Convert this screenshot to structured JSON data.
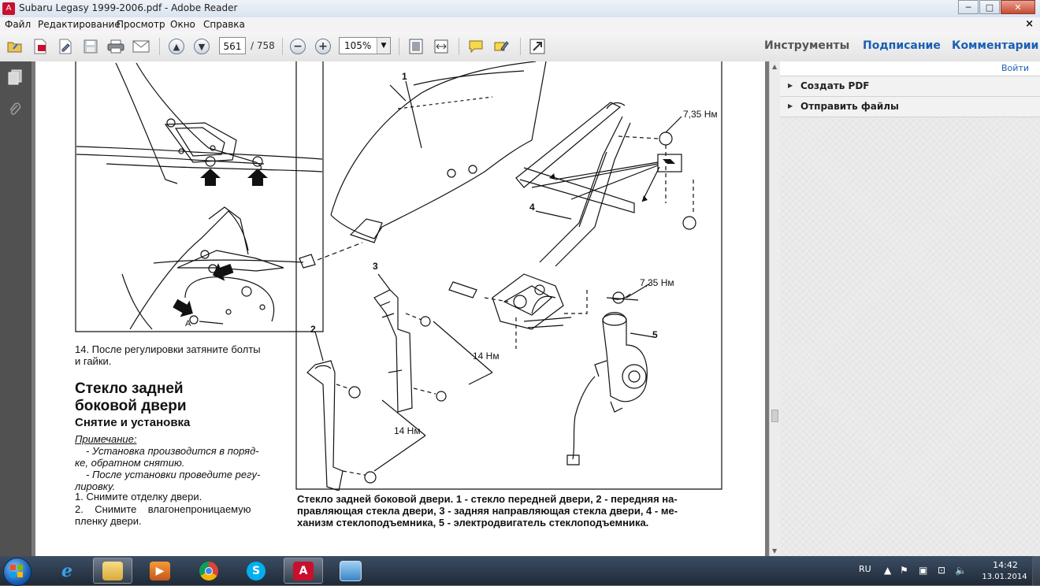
{
  "window": {
    "title": "Subaru Legasy 1999-2006.pdf - Adobe Reader",
    "min": "─",
    "max": "□",
    "close": "✕"
  },
  "menu": {
    "items": [
      "Файл",
      "Редактирование",
      "Просмотр",
      "Окно",
      "Справка"
    ],
    "close": "×"
  },
  "toolbar": {
    "page_current": "561",
    "page_total": "/ 758",
    "zoom": "105%"
  },
  "panels": {
    "tools": "Инструменты",
    "sign": "Подписание",
    "comments": "Комментарии"
  },
  "right_pane": {
    "login": "Войти",
    "create_pdf": "Создать PDF",
    "send_files": "Отправить файлы"
  },
  "doc": {
    "step14": [
      "14. После регулировки затяните болты",
      "и гайки."
    ],
    "heading1": [
      "Стекло задней",
      "боковой двери"
    ],
    "heading2": "Снятие и установка",
    "note_label": "Примечание:",
    "note_lines": [
      "- Установка производится в поряд-",
      "ке, обратном снятию.",
      "- После установки проведите регу-",
      "лировку."
    ],
    "step1": "1. Снимите отделку двери.",
    "step2a": "2.    Снимите    влагонепроницаемую",
    "step2b": "пленку двери.",
    "caption": [
      "Стекло задней боковой двери. 1 - стекло передней двери, 2 - передняя на-",
      "правляющая стекла двери, 3 - задняя направляющая стекла двери, 4 - ме-",
      "ханизм стеклоподъемника, 5 - электродвигатель стеклоподъемника."
    ],
    "callouts": {
      "n1": "1",
      "n2": "2",
      "n3": "3",
      "n4": "4",
      "n5": "5",
      "a": "A",
      "t735a": "7,35 Нм",
      "t735b": "7,35 Нм",
      "t14a": "14 Нм",
      "t14b": "14 Нм"
    }
  },
  "taskbar": {
    "lang": "RU",
    "time": "14:42",
    "date": "13.01.2014"
  },
  "colors": {
    "accent": "#1a5fb4",
    "pdf_red": "#c8102e",
    "taskbar": "#1f2a38"
  }
}
